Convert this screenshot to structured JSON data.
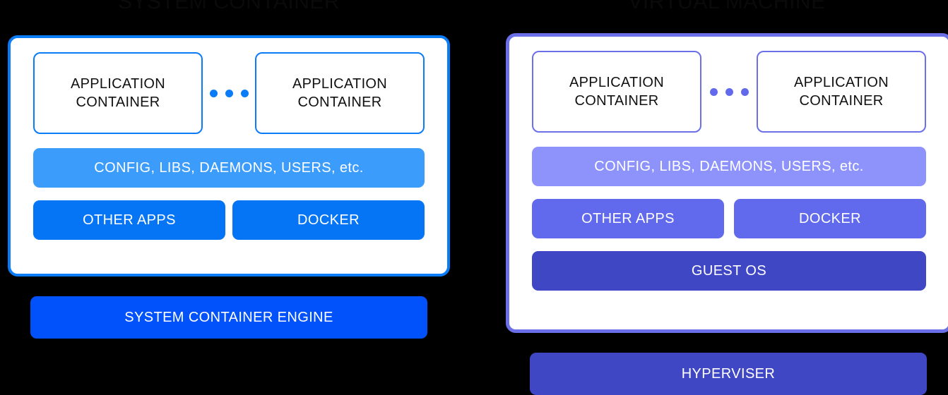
{
  "diagram": {
    "background_color": "#000000",
    "title_color": "#0a0a0a"
  },
  "left_panel": {
    "title": "SYSTEM CONTAINER",
    "accent_color": "#0a7cf8",
    "app_containers": [
      {
        "line1": "APPLICATION",
        "line2": "CONTAINER"
      },
      {
        "line1": "APPLICATION",
        "line2": "CONTAINER"
      }
    ],
    "ellipsis": "• • •",
    "config_bar": {
      "label": "CONFIG, LIBS, DAEMONS, USERS, etc.",
      "color": "#3b9cfb"
    },
    "apps_row": [
      {
        "label": "OTHER APPS",
        "color": "#0575f6"
      },
      {
        "label": "DOCKER",
        "color": "#0575f6"
      }
    ],
    "engine_bar": {
      "label": "SYSTEM CONTAINER ENGINE",
      "color": "#0152fa"
    }
  },
  "right_panel": {
    "title": "VIRTUAL MACHINE",
    "accent_color": "#6c70e8",
    "app_containers": [
      {
        "line1": "APPLICATION",
        "line2": "CONTAINER"
      },
      {
        "line1": "APPLICATION",
        "line2": "CONTAINER"
      }
    ],
    "ellipsis": "• • •",
    "config_bar": {
      "label": "CONFIG, LIBS, DAEMONS, USERS, etc.",
      "color": "#8e93fc"
    },
    "apps_row": [
      {
        "label": "OTHER APPS",
        "color": "#6169ec"
      },
      {
        "label": "DOCKER",
        "color": "#6169ec"
      }
    ],
    "guest_os_bar": {
      "label": "GUEST OS",
      "color": "#3f47c4"
    },
    "hyperviser_bar": {
      "label": "HYPERVISER",
      "color": "#3f47c4"
    }
  }
}
